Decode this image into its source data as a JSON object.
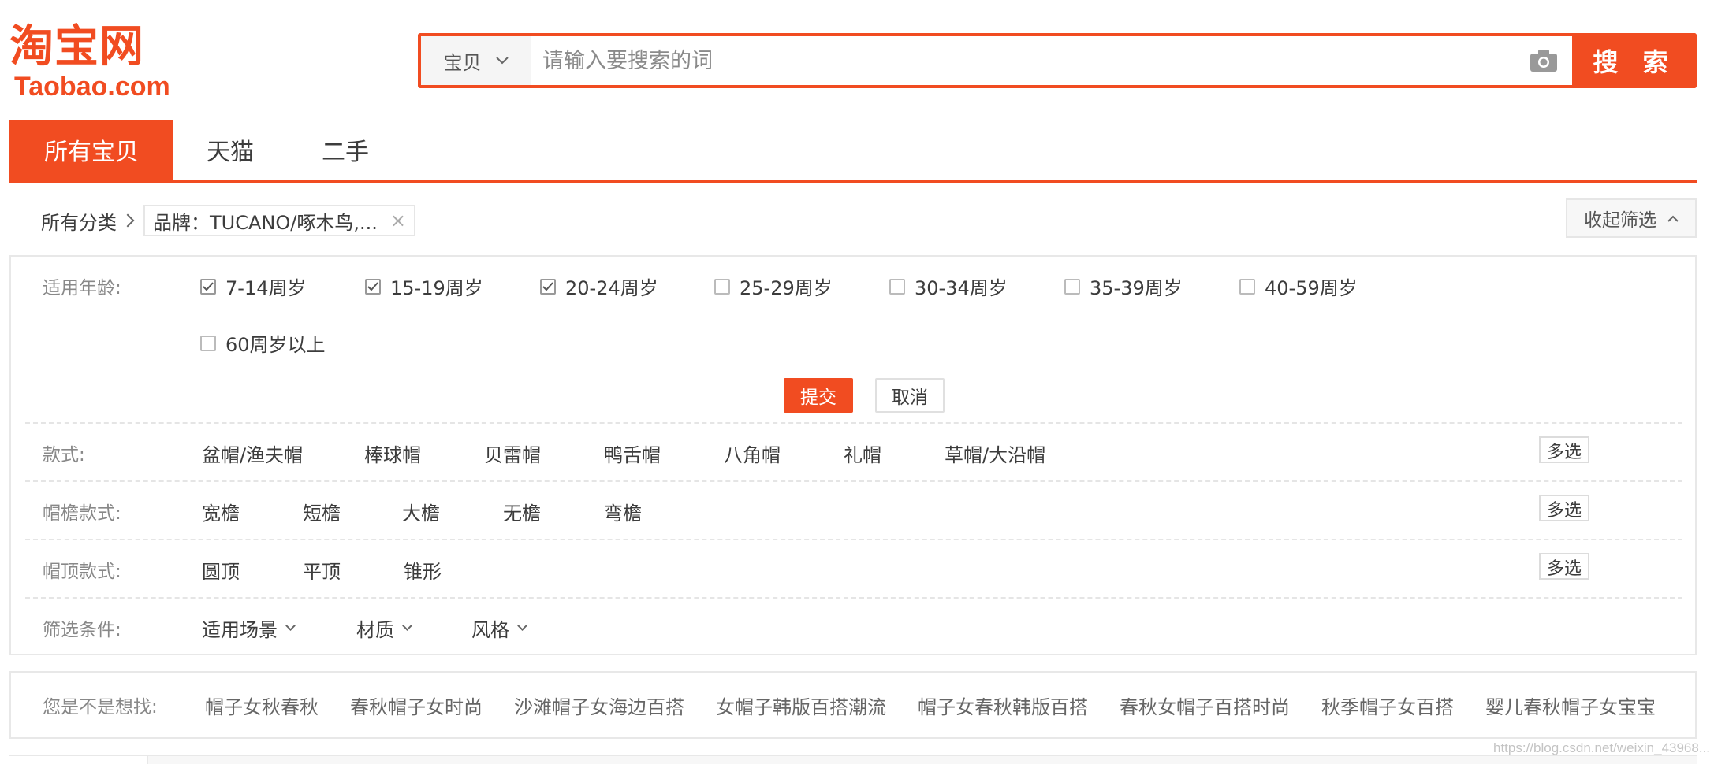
{
  "logo": {
    "cn": "淘宝网",
    "en": "Taobao.com"
  },
  "search": {
    "type_label": "宝贝",
    "placeholder": "请输入要搜索的词",
    "button_label": "搜 索"
  },
  "tabs": [
    {
      "label": "所有宝贝",
      "active": true
    },
    {
      "label": "天猫",
      "active": false
    },
    {
      "label": "二手",
      "active": false
    }
  ],
  "breadcrumb": {
    "root": "所有分类",
    "tag": "品牌：TUCANO/啄木鸟,...",
    "tag_close": "×"
  },
  "collapse_label": "收起筛选",
  "age_filter": {
    "label": "适用年龄:",
    "options": [
      {
        "label": "7-14周岁",
        "checked": true
      },
      {
        "label": "15-19周岁",
        "checked": true
      },
      {
        "label": "20-24周岁",
        "checked": true
      },
      {
        "label": "25-29周岁",
        "checked": false
      },
      {
        "label": "30-34周岁",
        "checked": false
      },
      {
        "label": "35-39周岁",
        "checked": false
      },
      {
        "label": "40-59周岁",
        "checked": false
      },
      {
        "label": "60周岁以上",
        "checked": false
      }
    ],
    "submit_label": "提交",
    "cancel_label": "取消"
  },
  "style_filter": {
    "label": "款式:",
    "options": [
      "盆帽/渔夫帽",
      "棒球帽",
      "贝雷帽",
      "鸭舌帽",
      "八角帽",
      "礼帽",
      "草帽/大沿帽"
    ],
    "multi_label": "多选"
  },
  "brim_filter": {
    "label": "帽檐款式:",
    "options": [
      "宽檐",
      "短檐",
      "大檐",
      "无檐",
      "弯檐"
    ],
    "multi_label": "多选"
  },
  "top_filter": {
    "label": "帽顶款式:",
    "options": [
      "圆顶",
      "平顶",
      "锥形"
    ],
    "multi_label": "多选"
  },
  "conditions": {
    "label": "筛选条件:",
    "options": [
      "适用场景",
      "材质",
      "风格"
    ]
  },
  "suggestions": {
    "label": "您是不是想找:",
    "items": [
      "帽子女秋春秋",
      "春秋帽子女时尚",
      "沙滩帽子女海边百搭",
      "女帽子韩版百搭潮流",
      "帽子女春秋韩版百搭",
      "春秋女帽子百搭时尚",
      "秋季帽子女百搭",
      "婴儿春秋帽子女宝宝"
    ]
  },
  "watermark": "https://blog.csdn.net/weixin_43968..."
}
